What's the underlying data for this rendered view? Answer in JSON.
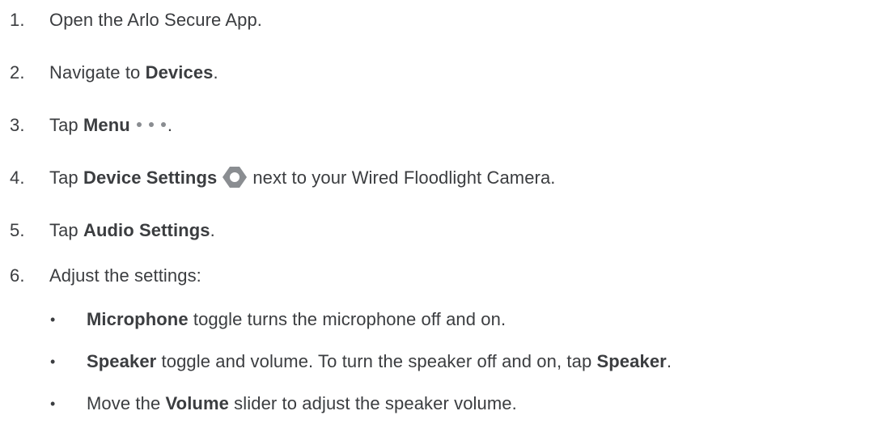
{
  "steps": [
    {
      "num": "1.",
      "text": "Open the Arlo Secure App."
    },
    {
      "num": "2.",
      "pre": "Navigate to ",
      "bold": "Devices",
      "post": "."
    },
    {
      "num": "3.",
      "pre": "Tap ",
      "bold": "Menu",
      "post": ".",
      "icon": "more-dots-icon"
    },
    {
      "num": "4.",
      "pre": "Tap ",
      "bold": "Device Settings",
      "post": "next to your Wired Floodlight Camera.",
      "icon": "gear-icon"
    },
    {
      "num": "5.",
      "pre": "Tap ",
      "bold": "Audio Settings",
      "post": "."
    },
    {
      "num": "6.",
      "text": "Adjust the settings:"
    }
  ],
  "bullets": [
    {
      "bold": "Microphone",
      "post": " toggle turns the microphone off and on."
    },
    {
      "bold": "Speaker",
      "post": " toggle and volume. To turn the speaker off and on, tap ",
      "bold2": "Speaker",
      "post2": "."
    },
    {
      "pre": "Move the ",
      "bold": "Volume",
      "post": " slider to adjust the speaker volume."
    }
  ],
  "bullet_char": "•",
  "colors": {
    "text": "#3b3d40",
    "icon": "#8a8d91"
  }
}
